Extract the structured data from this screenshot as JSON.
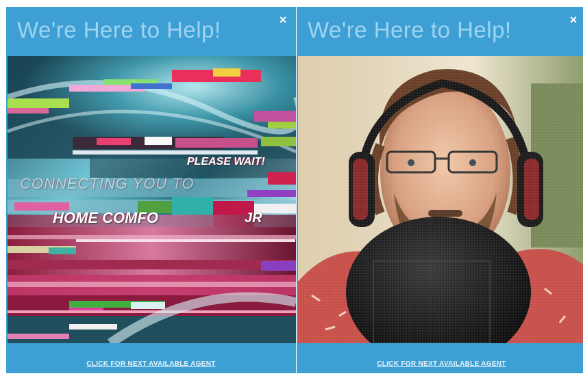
{
  "panels": [
    {
      "title": "We're Here to Help!",
      "close": "×",
      "footer_link": "CLICK FOR NEXT AVAILABLE AGENT",
      "video_text": {
        "please_wait": "PLEASE WAIT!",
        "connecting": "CONNECTING YOU TO",
        "home_comfort": "HOME COMFO",
        "tail": "JR"
      }
    },
    {
      "title": "We're Here to Help!",
      "close": "×",
      "footer_link": "CLICK FOR NEXT AVAILABLE AGENT"
    }
  ],
  "colors": {
    "panel_bg": "#3d9fd4",
    "title": "#9fd4f0"
  },
  "icons": {
    "close": "close-icon"
  }
}
